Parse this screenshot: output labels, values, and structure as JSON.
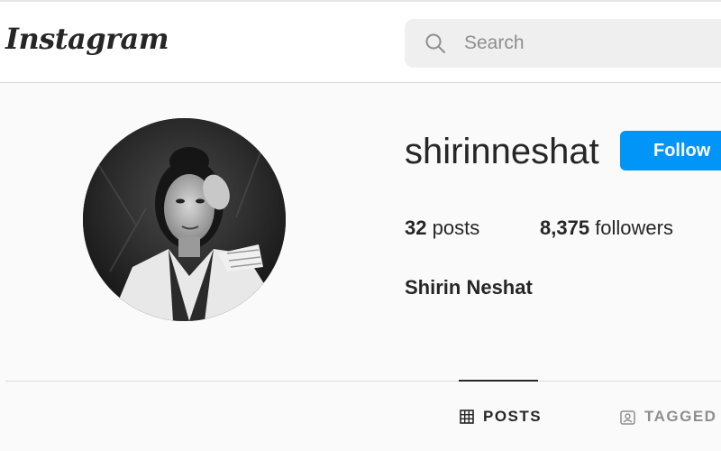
{
  "header": {
    "logo_text": "Instagram",
    "search_placeholder": "Search"
  },
  "profile": {
    "username": "shirinneshat",
    "follow_label": "Follow",
    "posts_count": "32",
    "posts_label": "posts",
    "followers_count": "8,375",
    "followers_label": "followers",
    "full_name": "Shirin Neshat"
  },
  "tabs": [
    {
      "label": "POSTS",
      "icon": "grid-icon",
      "active": true
    },
    {
      "label": "TAGGED",
      "icon": "tagged-icon",
      "active": false
    }
  ],
  "colors": {
    "accent": "#0095f6",
    "text": "#262626",
    "muted": "#8e8e8e",
    "background": "#fafafa"
  }
}
